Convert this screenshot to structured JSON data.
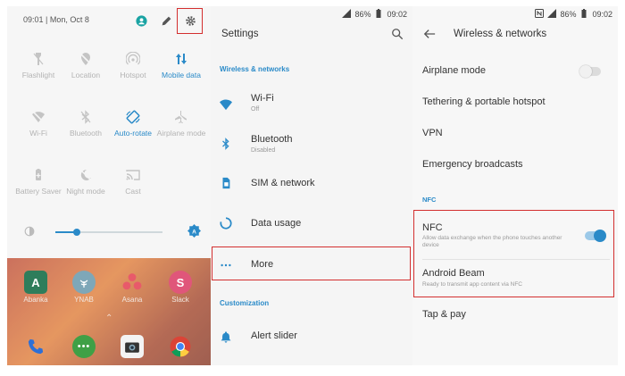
{
  "panel1": {
    "status_time": "09:01 | Mon, Oct 8",
    "header_icons": [
      "account-icon",
      "edit-icon",
      "gear-icon"
    ],
    "tiles": [
      {
        "label": "Flashlight",
        "icon": "flashlight-icon",
        "active": false
      },
      {
        "label": "Location",
        "icon": "location-icon",
        "active": false
      },
      {
        "label": "Hotspot",
        "icon": "hotspot-icon",
        "active": false
      },
      {
        "label": "Mobile data",
        "icon": "mobile-data-icon",
        "active": true
      },
      {
        "label": "Wi-Fi",
        "icon": "wifi-icon",
        "active": false
      },
      {
        "label": "Bluetooth",
        "icon": "bluetooth-icon",
        "active": false
      },
      {
        "label": "Auto-rotate",
        "icon": "auto-rotate-icon",
        "active": true
      },
      {
        "label": "Airplane mode",
        "icon": "airplane-icon",
        "active": false
      },
      {
        "label": "Battery Saver",
        "icon": "battery-saver-icon",
        "active": false
      },
      {
        "label": "Night mode",
        "icon": "night-mode-icon",
        "active": false
      },
      {
        "label": "Cast",
        "icon": "cast-icon",
        "active": false
      }
    ],
    "brightness_level": 0.2,
    "apps": [
      {
        "label": "Abanka",
        "letter": "A",
        "color": "#2e7d5b"
      },
      {
        "label": "YNAB",
        "letter": "Y",
        "color": "#7ea7b8"
      },
      {
        "label": "Asana",
        "letter": "",
        "color": "#e06a6a"
      },
      {
        "label": "Slack",
        "letter": "S",
        "color": "#e0567a"
      }
    ],
    "dock": [
      "phone-icon",
      "messages-icon",
      "camera-icon",
      "chrome-icon"
    ]
  },
  "status": {
    "battery": "86%",
    "time": "09:02"
  },
  "panel2": {
    "title": "Settings",
    "section1": "Wireless & networks",
    "items": [
      {
        "title": "Wi-Fi",
        "subtitle": "Off",
        "icon": "wifi-icon"
      },
      {
        "title": "Bluetooth",
        "subtitle": "Disabled",
        "icon": "bluetooth-icon"
      },
      {
        "title": "SIM & network",
        "subtitle": "",
        "icon": "sim-icon"
      },
      {
        "title": "Data usage",
        "subtitle": "",
        "icon": "data-usage-icon"
      },
      {
        "title": "More",
        "subtitle": "",
        "icon": "more-dots-icon"
      }
    ],
    "section2": "Customization",
    "items2": [
      {
        "title": "Alert slider",
        "subtitle": "",
        "icon": "bell-icon"
      }
    ]
  },
  "panel3": {
    "title": "Wireless & networks",
    "items": [
      {
        "title": "Airplane mode"
      },
      {
        "title": "Tethering & portable hotspot"
      },
      {
        "title": "VPN"
      },
      {
        "title": "Emergency broadcasts"
      }
    ],
    "nfc_section": "NFC",
    "nfc": {
      "title": "NFC",
      "subtitle": "Allow data exchange when the phone touches another device",
      "enabled": true
    },
    "beam": {
      "title": "Android Beam",
      "subtitle": "Ready to transmit app content via NFC"
    },
    "tap_pay": "Tap & pay",
    "airplane_enabled": false
  },
  "colors": {
    "accent": "#2a8ac8",
    "highlight_box": "#d32f2f"
  }
}
